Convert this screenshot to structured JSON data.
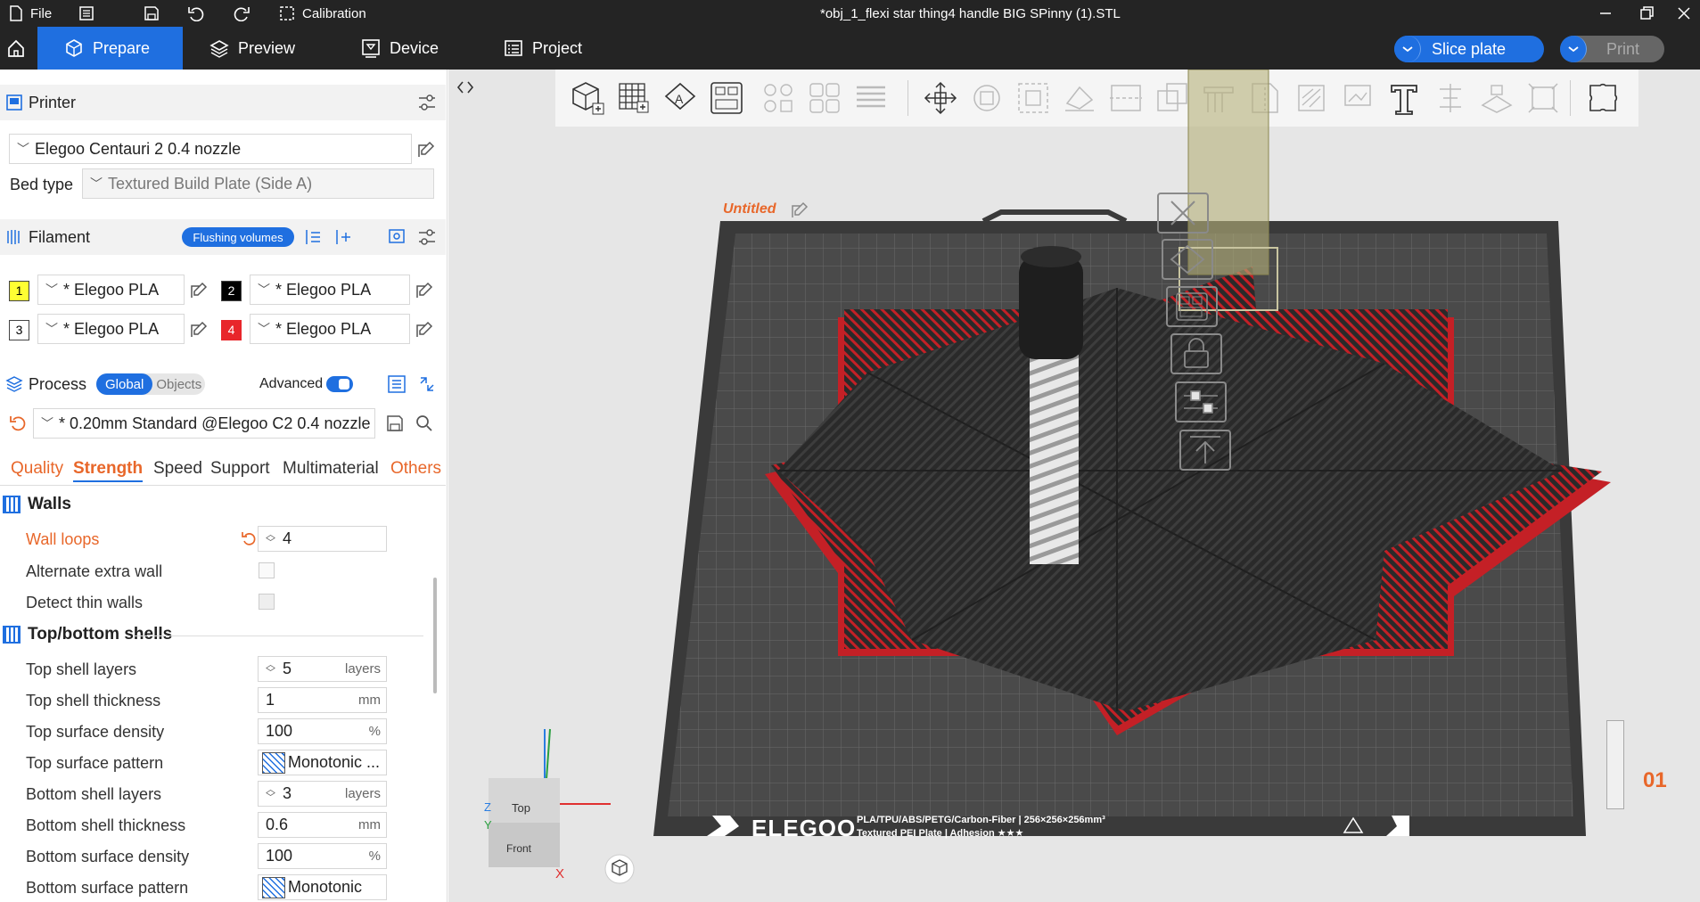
{
  "titlebar": {
    "file_label": "File",
    "calibration_label": "Calibration",
    "window_title": "*obj_1_flexi star thing4 handle BIG SPinny (1).STL"
  },
  "nav": {
    "tabs": [
      {
        "label": "Prepare"
      },
      {
        "label": "Preview"
      },
      {
        "label": "Device"
      },
      {
        "label": "Project"
      }
    ],
    "slice_label": "Slice plate",
    "print_label": "Print"
  },
  "printer": {
    "header": "Printer",
    "name": "Elegoo Centauri 2 0.4 nozzle",
    "bed_type_label": "Bed type",
    "bed_type_value": "Textured Build Plate (Side A)"
  },
  "filament": {
    "header": "Filament",
    "flushing_label": "Flushing volumes",
    "slots": [
      {
        "num": "1",
        "name": "* Elegoo PLA",
        "color": "#ffff33",
        "text_color": "#000000"
      },
      {
        "num": "2",
        "name": "* Elegoo PLA",
        "color": "#000000",
        "text_color": "#ffffff"
      },
      {
        "num": "3",
        "name": "* Elegoo PLA",
        "color": "#ffffff",
        "text_color": "#000000"
      },
      {
        "num": "4",
        "name": "* Elegoo PLA",
        "color": "#e8262b",
        "text_color": "#ffffff"
      }
    ]
  },
  "process": {
    "header": "Process",
    "global_label": "Global",
    "objects_label": "Objects",
    "advanced_label": "Advanced",
    "preset": "* 0.20mm Standard @Elegoo C2 0.4 nozzle",
    "tabs": [
      "Quality",
      "Strength",
      "Speed",
      "Support",
      "Multimaterial",
      "Others"
    ],
    "walls_header": "Walls",
    "wall_loops_label": "Wall loops",
    "wall_loops_value": "4",
    "alternate_extra_wall_label": "Alternate extra wall",
    "detect_thin_walls_label": "Detect thin walls",
    "shells_header": "Top/bottom shells",
    "top_shell_layers_label": "Top shell layers",
    "top_shell_layers_value": "5",
    "top_shell_layers_unit": "layers",
    "top_shell_thickness_label": "Top shell thickness",
    "top_shell_thickness_value": "1",
    "top_shell_thickness_unit": "mm",
    "top_surface_density_label": "Top surface density",
    "top_surface_density_value": "100",
    "top_surface_density_unit": "%",
    "top_surface_pattern_label": "Top surface pattern",
    "top_surface_pattern_value": "Monotonic ...",
    "bottom_shell_layers_label": "Bottom shell layers",
    "bottom_shell_layers_value": "3",
    "bottom_shell_layers_unit": "layers",
    "bottom_shell_thickness_label": "Bottom shell thickness",
    "bottom_shell_thickness_value": "0.6",
    "bottom_shell_thickness_unit": "mm",
    "bottom_surface_density_label": "Bottom surface density",
    "bottom_surface_density_value": "100",
    "bottom_surface_density_unit": "%",
    "bottom_surface_pattern_label": "Bottom surface pattern",
    "bottom_surface_pattern_value": "Monotonic"
  },
  "viewport": {
    "plate_name": "Untitled",
    "plate_number": "01",
    "brand": "ELEGOO",
    "plate_info_line1": "PLA/TPU/ABS/PETG/Carbon-Fiber | 256×256×256mm³",
    "plate_info_line2": "Textured PEI Plate | Adhesion ★★★",
    "view_top": "Top",
    "view_front": "Front",
    "axis_x": "X",
    "axis_y": "Y",
    "axis_z": "Z"
  },
  "colors": {
    "accent": "#1f6fe0",
    "orange": "#e8672a",
    "dark": "#242424"
  }
}
